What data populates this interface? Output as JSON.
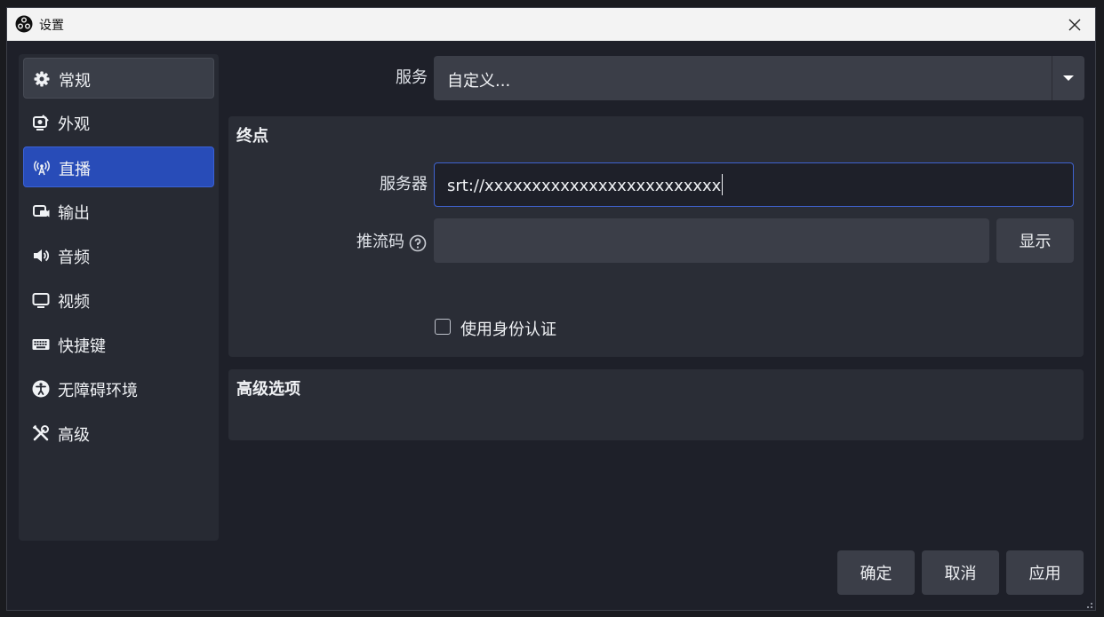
{
  "window": {
    "title": "设置"
  },
  "sidebar": {
    "items": [
      {
        "label": "常规",
        "icon": "gear-icon",
        "state": "hover"
      },
      {
        "label": "外观",
        "icon": "appearance-icon",
        "state": "normal"
      },
      {
        "label": "直播",
        "icon": "broadcast-antenna-icon",
        "state": "active"
      },
      {
        "label": "输出",
        "icon": "output-icon",
        "state": "normal"
      },
      {
        "label": "音频",
        "icon": "speaker-icon",
        "state": "normal"
      },
      {
        "label": "视频",
        "icon": "monitor-icon",
        "state": "normal"
      },
      {
        "label": "快捷键",
        "icon": "keyboard-icon",
        "state": "normal"
      },
      {
        "label": "无障碍环境",
        "icon": "accessibility-icon",
        "state": "normal"
      },
      {
        "label": "高级",
        "icon": "tools-icon",
        "state": "normal"
      }
    ]
  },
  "stream": {
    "service_label": "服务",
    "service_value": "自定义...",
    "endpoint_title": "终点",
    "server_label": "服务器",
    "server_value": "srt://xxxxxxxxxxxxxxxxxxxxxxxxx",
    "stream_key_label": "推流码",
    "stream_key_value": "",
    "show_button": "显示",
    "use_auth_label": "使用身份认证",
    "use_auth_checked": false,
    "advanced_title": "高级选项"
  },
  "footer": {
    "ok": "确定",
    "cancel": "取消",
    "apply": "应用"
  },
  "colors": {
    "accent": "#284cb8",
    "background": "#1e2029",
    "panel": "#2a2d36",
    "input": "#3b3e48"
  }
}
